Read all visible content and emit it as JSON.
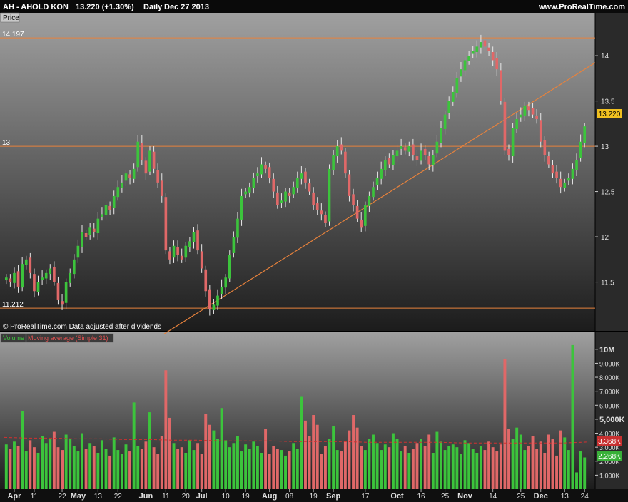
{
  "header": {
    "symbol": "AH - AHOLD KON",
    "price": "13.220 (+1.30%)",
    "period": "Daily",
    "date": "Dec 27 2013",
    "site": "www.ProRealTime.com"
  },
  "price_panel": {
    "label": "Price",
    "copyright": "© ProRealTime.com  Data adjusted after dividends",
    "last_price_badge": "13.220",
    "hline_labels": [
      "14.197",
      "13",
      "11.212"
    ]
  },
  "volume_panel": {
    "legend_volume": "Volume",
    "legend_ma": "Moving average (Simple 31)",
    "badge_ma": "3,368K",
    "badge_volume": "2,268K"
  },
  "colors": {
    "up": "#3cc43c",
    "down": "#e06868",
    "line": "#e8823c",
    "ma": "#d23030",
    "text": "#ffffff",
    "axis_text": "#e0e0e0"
  },
  "chart_data": [
    {
      "type": "candlestick",
      "title": "AH - AHOLD KON",
      "ylabel": "Price",
      "ylim": [
        11.15,
        14.3
      ],
      "yticks": [
        "14",
        "13.5",
        "13",
        "12.5",
        "12",
        "11.5"
      ],
      "horizontal_lines": [
        14.197,
        13.0,
        11.212
      ],
      "trendline": {
        "from": {
          "date": "Jun 3",
          "price": 11.05
        },
        "to": {
          "date": "Dec 27",
          "price": 13.85
        }
      },
      "last_close": 13.22,
      "closes": [
        11.55,
        11.5,
        11.6,
        11.45,
        11.7,
        11.75,
        11.6,
        11.4,
        11.5,
        11.55,
        11.6,
        11.65,
        11.5,
        11.3,
        11.25,
        11.5,
        11.6,
        11.75,
        11.9,
        12.05,
        12.0,
        12.1,
        12.05,
        12.2,
        12.25,
        12.35,
        12.3,
        12.45,
        12.55,
        12.6,
        12.7,
        12.65,
        12.75,
        13.05,
        12.85,
        12.7,
        12.95,
        12.75,
        12.6,
        12.45,
        11.85,
        11.75,
        11.9,
        11.8,
        11.75,
        11.9,
        11.95,
        12.05,
        11.85,
        11.65,
        11.4,
        11.2,
        11.25,
        11.35,
        11.45,
        11.55,
        11.8,
        12.0,
        12.2,
        12.45,
        12.5,
        12.55,
        12.65,
        12.7,
        12.8,
        12.75,
        12.65,
        12.5,
        12.35,
        12.4,
        12.5,
        12.45,
        12.55,
        12.65,
        12.7,
        12.6,
        12.5,
        12.35,
        12.3,
        12.25,
        12.15,
        12.75,
        12.9,
        13.0,
        12.95,
        12.7,
        12.45,
        12.35,
        12.2,
        12.1,
        12.35,
        12.45,
        12.55,
        12.65,
        12.75,
        12.85,
        12.8,
        12.9,
        12.95,
        13.0,
        12.95,
        13.0,
        12.9,
        12.85,
        12.95,
        12.9,
        12.8,
        12.9,
        13.05,
        13.2,
        13.35,
        13.5,
        13.6,
        13.75,
        13.85,
        13.95,
        14.0,
        14.05,
        14.1,
        14.15,
        14.1,
        14.05,
        13.95,
        13.85,
        13.5,
        12.95,
        12.9,
        13.2,
        13.3,
        13.35,
        13.45,
        13.4,
        13.35,
        13.3,
        13.05,
        12.9,
        12.8,
        12.7,
        12.65,
        12.55,
        12.6,
        12.65,
        12.75,
        12.85,
        13.05,
        13.22
      ]
    },
    {
      "type": "bar",
      "title": "Volume",
      "series_names": [
        "Volume",
        "Moving average (Simple 31)"
      ],
      "ylim": [
        0,
        10500
      ],
      "unit": "thousands",
      "yticks": [
        "10M",
        "9,000K",
        "8,000K",
        "7,000K",
        "6,000K",
        "5,000K",
        "4,000K",
        "3,000K",
        "2,000K",
        "1,000K"
      ],
      "xticks": [
        "Apr",
        "11",
        "22",
        "May",
        "13",
        "22",
        "Jun",
        "11",
        "20",
        "Jul",
        "10",
        "19",
        "Aug",
        "08",
        "19",
        "Sep",
        "17",
        "Oct",
        "16",
        "25",
        "Nov",
        "14",
        "25",
        "Dec",
        "13",
        "24"
      ],
      "volumes": [
        3200,
        2900,
        3400,
        3100,
        5600,
        2700,
        3500,
        3000,
        2600,
        3800,
        3300,
        3600,
        4100,
        3000,
        2800,
        3900,
        3600,
        3100,
        2700,
        4000,
        2900,
        3300,
        3100,
        2600,
        3500,
        2900,
        2400,
        3700,
        2800,
        2500,
        3200,
        2700,
        6200,
        3100,
        2900,
        3400,
        5500,
        3000,
        2500,
        3800,
        8500,
        5100,
        3300,
        2900,
        3000,
        2600,
        3500,
        2800,
        3300,
        2500,
        5400,
        4600,
        4200,
        3600,
        5800,
        3500,
        3000,
        3300,
        3800,
        2700,
        3200,
        2900,
        3400,
        3100,
        2600,
        4300,
        2500,
        3100,
        2900,
        2800,
        2400,
        2700,
        3300,
        2900,
        6600,
        4900,
        3800,
        5300,
        4600,
        2500,
        3100,
        3600,
        4500,
        2800,
        2700,
        3400,
        4200,
        5300,
        4400,
        3100,
        2800,
        3600,
        3900,
        3300,
        2800,
        3200,
        3000,
        4000,
        3600,
        2700,
        3100,
        2600,
        2900,
        3300,
        3600,
        3100,
        3900,
        2600,
        4100,
        3400,
        2800,
        3100,
        3200,
        3000,
        2500,
        3500,
        3300,
        2900,
        2600,
        3100,
        2800,
        3400,
        3000,
        2700,
        3200,
        9300,
        4300,
        3600,
        4400,
        3900,
        2800,
        3100,
        3800,
        2900,
        3400,
        2600,
        3900,
        3600,
        2400,
        4200,
        3700,
        2800,
        10300,
        1200,
        2700,
        2268
      ],
      "ma": [
        3700,
        3650,
        3650,
        3600,
        3600,
        3550,
        3550,
        3500,
        3500,
        3450,
        3450,
        3450,
        3400,
        3400,
        3400,
        3350,
        3350,
        3350,
        3350,
        3300,
        3300,
        3300,
        3300,
        3300,
        3368
      ]
    }
  ]
}
